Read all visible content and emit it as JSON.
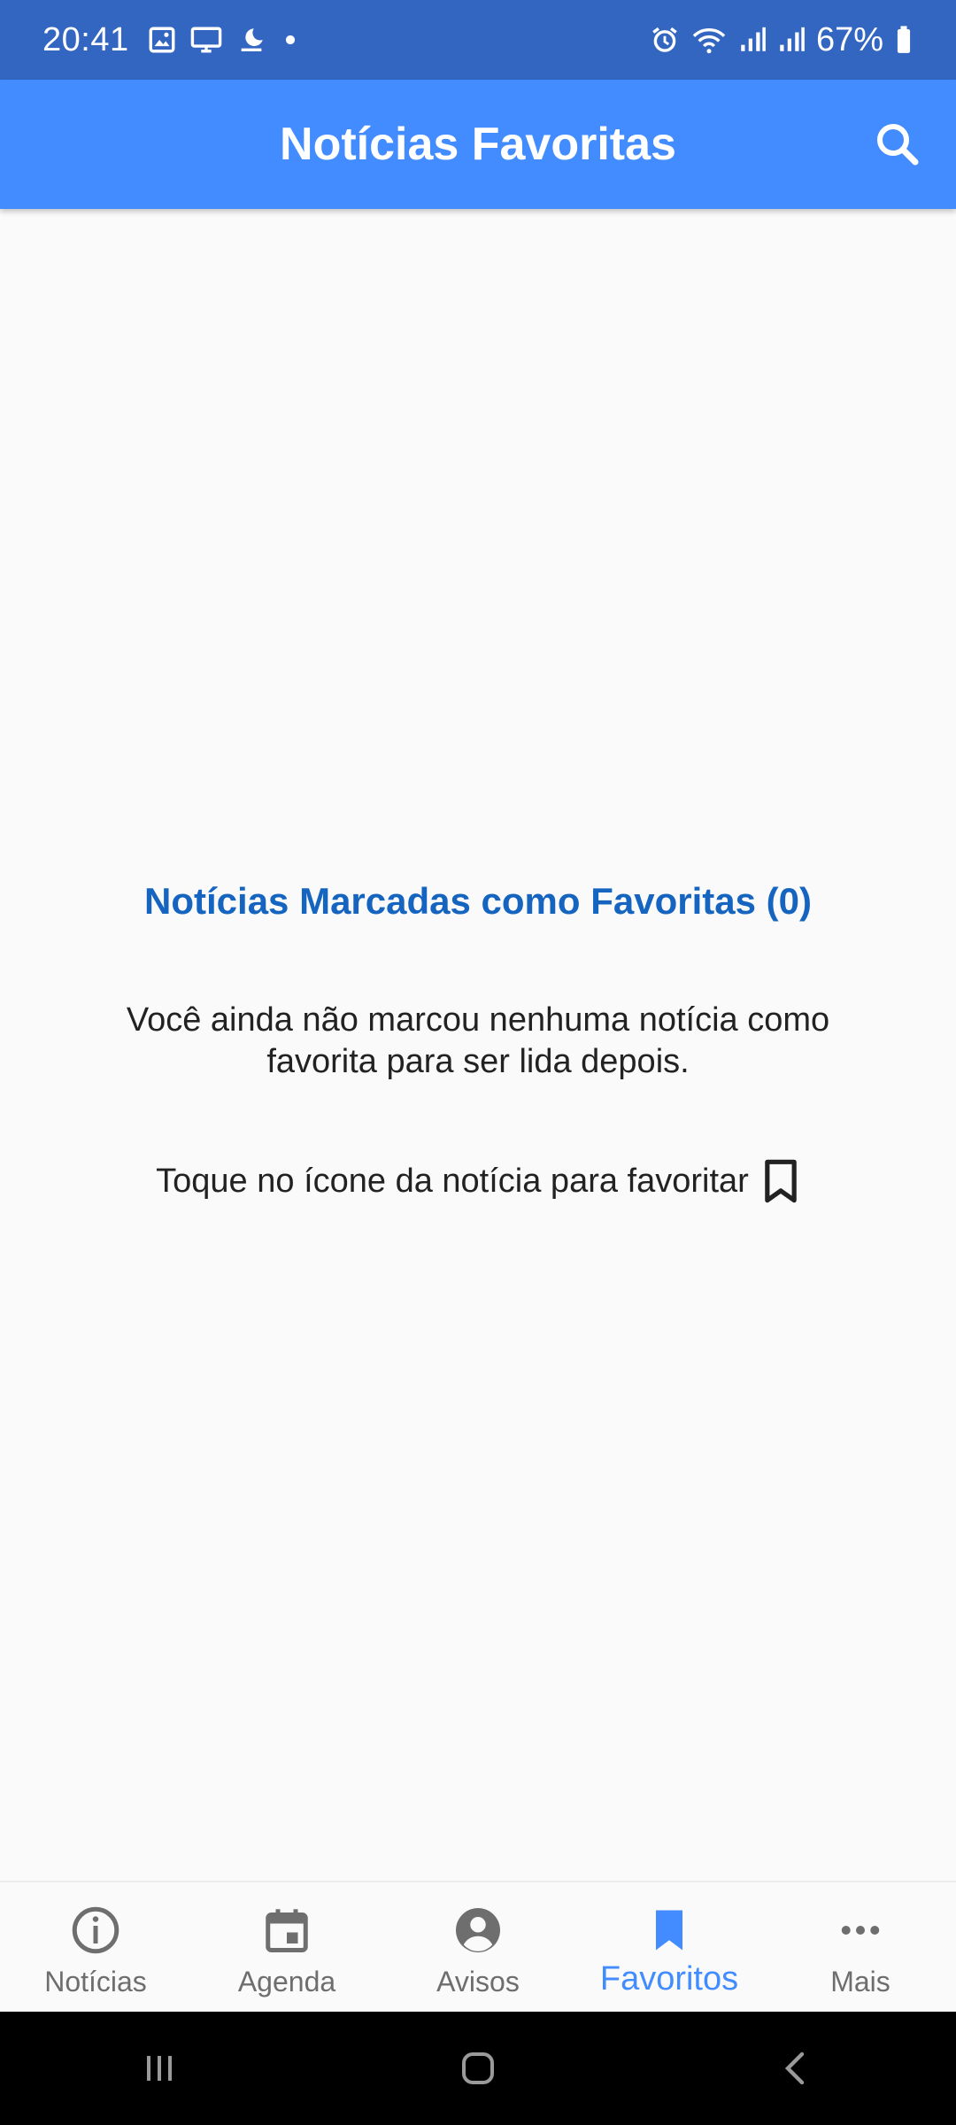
{
  "status_bar": {
    "time": "20:41",
    "battery_percent": "67%",
    "left_icons": [
      "gallery-icon",
      "screen-cast-icon",
      "weather-icon",
      "dot-icon"
    ],
    "right_icons": [
      "alarm-icon",
      "wifi-icon",
      "signal-icon",
      "signal-icon",
      "battery-icon"
    ]
  },
  "app_bar": {
    "title": "Notícias Favoritas",
    "search_icon": "search-icon",
    "color": "#428cff"
  },
  "empty_state": {
    "title": "Notícias Marcadas como Favoritas (0)",
    "description": "Você ainda não marcou nenhuma notícia como favorita para ser lida depois.",
    "hint": "Toque no ícone da notícia para favoritar",
    "hint_icon": "bookmark-outline-icon",
    "title_color": "#1565c0"
  },
  "bottom_nav": {
    "items": [
      {
        "label": "Notícias",
        "icon": "info-icon",
        "active": false
      },
      {
        "label": "Agenda",
        "icon": "calendar-icon",
        "active": false
      },
      {
        "label": "Avisos",
        "icon": "account-circle-icon",
        "active": false
      },
      {
        "label": "Favoritos",
        "icon": "bookmark-icon",
        "active": true
      },
      {
        "label": "Mais",
        "icon": "more-horizontal-icon",
        "active": false
      }
    ],
    "active_color": "#428cff",
    "inactive_color": "#6e6e6e"
  },
  "system_nav": {
    "buttons": [
      "recent-apps-icon",
      "home-icon",
      "back-icon"
    ]
  }
}
